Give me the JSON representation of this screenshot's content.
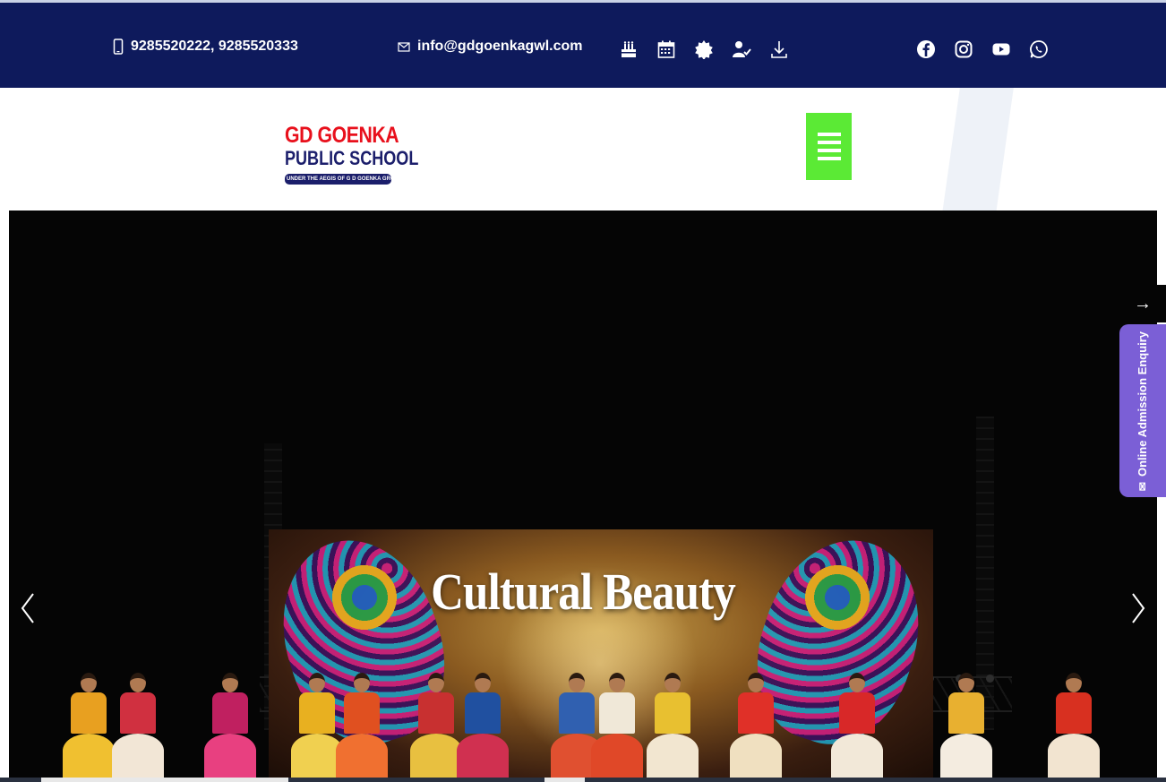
{
  "topbar": {
    "phone": "9285520222, 9285520333",
    "email": "info@gdgoenkagwl.com",
    "quick_icons": [
      "cake-icon",
      "calendar-icon",
      "badge-icon",
      "user-check-icon",
      "download-icon"
    ],
    "social_icons": [
      "facebook-icon",
      "instagram-icon",
      "youtube-icon",
      "whatsapp-icon"
    ],
    "background": "#0e1a5c"
  },
  "header": {
    "logo": {
      "line1": "GD GOENKA",
      "line2": "PUBLIC SCHOOL",
      "tagline": "UNDER THE AEGIS OF G D GOENKA GROUP"
    },
    "menu_button_color": "#5bea35"
  },
  "hero": {
    "slide_title": "Cultural Beauty",
    "prev_icon": "chevron-left-icon",
    "next_icon": "chevron-right-icon"
  },
  "side_panel": {
    "toggle_glyph": "→",
    "enquiry_label": "Online Admission Enquiry",
    "color": "#7b5fd6"
  }
}
